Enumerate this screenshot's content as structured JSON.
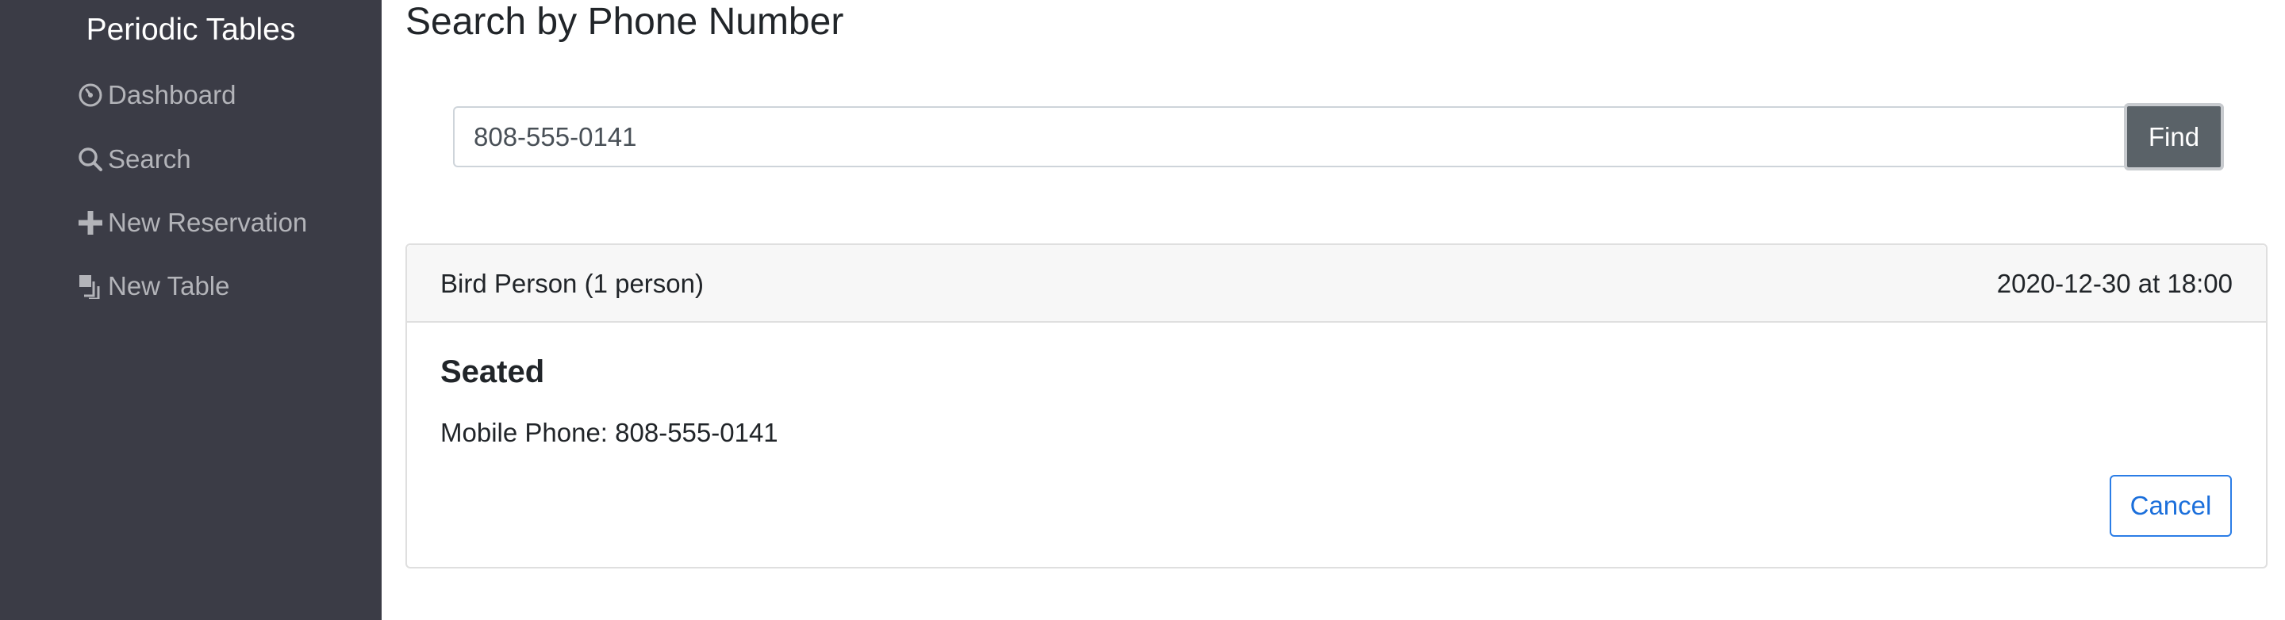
{
  "app": {
    "title": "Periodic Tables"
  },
  "sidebar": {
    "items": [
      {
        "label": "Dashboard",
        "icon": "dashboard-gauge-icon"
      },
      {
        "label": "Search",
        "icon": "search-icon"
      },
      {
        "label": "New Reservation",
        "icon": "plus-icon"
      },
      {
        "label": "New Table",
        "icon": "layers-icon"
      }
    ]
  },
  "page": {
    "title": "Search by Phone Number"
  },
  "search": {
    "value": "808-555-0141",
    "button_label": "Find"
  },
  "results": [
    {
      "name": "Bird Person (1 person)",
      "datetime": "2020-12-30 at 18:00",
      "status": "Seated",
      "phone": "Mobile Phone: 808-555-0141",
      "cancel_label": "Cancel"
    }
  ],
  "colors": {
    "sidebar_bg": "#3b3c46",
    "sidebar_text": "#b3b4b9",
    "find_button_bg": "#5a6268",
    "cancel_accent": "#1b6fdb"
  }
}
